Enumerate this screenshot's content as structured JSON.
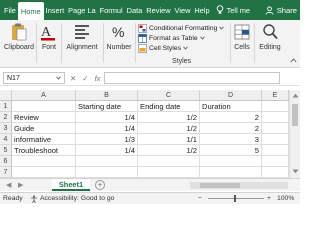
{
  "ribbon_tabs": [
    "File",
    "Home",
    "Insert",
    "Page La",
    "Formul",
    "Data",
    "Review",
    "View",
    "Help"
  ],
  "active_tab": "Home",
  "tell_me": "Tell me",
  "share": "Share",
  "groups": {
    "clipboard": "Clipboard",
    "font": "Font",
    "alignment": "Alignment",
    "number": "Number",
    "styles": "Styles",
    "cells": "Cells",
    "editing": "Editing"
  },
  "styles_list": [
    "Conditional Formatting",
    "Format as Table",
    "Cell Styles"
  ],
  "name_box": "N17",
  "fx": "fx",
  "columns": [
    "A",
    "B",
    "C",
    "D",
    "E"
  ],
  "rows": [
    "1",
    "2",
    "3",
    "4",
    "5",
    "6",
    "7"
  ],
  "cells": {
    "header": [
      "",
      "Starting date",
      "Ending date",
      "Duration"
    ],
    "data": [
      [
        "Review",
        "1/4",
        "1/2",
        "2"
      ],
      [
        "Guide",
        "1/4",
        "1/2",
        "2"
      ],
      [
        "informative",
        "1/3",
        "1/1",
        "3"
      ],
      [
        "Troubleshoot",
        "1/4",
        "1/2",
        "5"
      ]
    ]
  },
  "sheet_tab": "Sheet1",
  "add_sheet": "+",
  "status": {
    "ready": "Ready",
    "accessibility": "Accessibility: Good to go",
    "zoom": "100%",
    "zoom_minus": "−",
    "zoom_plus": "+"
  },
  "colors": {
    "brand": "#217346",
    "ribbon": "#f3f3f3",
    "icon_blue": "#2b579a",
    "accent_orange": "#f0a030"
  }
}
